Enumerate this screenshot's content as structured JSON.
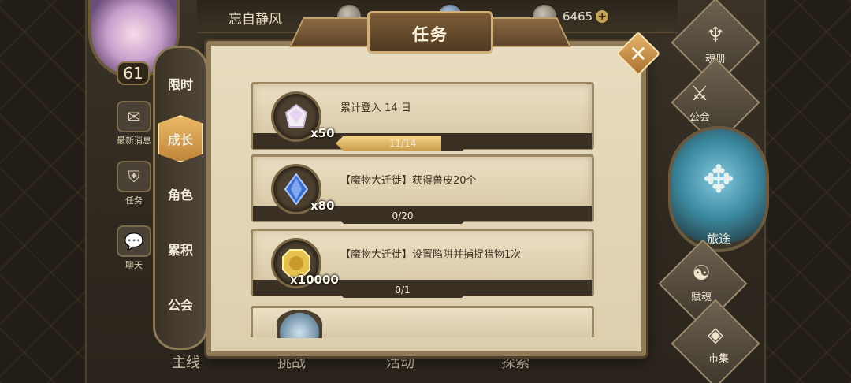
{
  "player": {
    "name": "忘自静风",
    "level": "61"
  },
  "resources": [
    {
      "icon": "silver-coin-icon",
      "value": ""
    },
    {
      "icon": "gem-icon",
      "value": ""
    },
    {
      "icon": "crystal-icon",
      "value": "6465"
    }
  ],
  "left_nav": [
    {
      "label": "最新消息",
      "icon": "news-icon"
    },
    {
      "label": "任务",
      "icon": "quest-icon"
    },
    {
      "label": "聊天",
      "icon": "chat-icon"
    }
  ],
  "dialog": {
    "title": "任务",
    "categories": [
      {
        "label": "限时",
        "active": false
      },
      {
        "label": "成长",
        "active": true
      },
      {
        "label": "角色",
        "active": false
      },
      {
        "label": "累积",
        "active": false
      },
      {
        "label": "公会",
        "active": false
      }
    ],
    "quests": [
      {
        "reward_icon": "crystal-icon",
        "qty": "x50",
        "desc": "累计登入 14 日",
        "progress_text": "11/14",
        "progress": 0.79
      },
      {
        "reward_icon": "blue-gem-icon",
        "qty": "x80",
        "desc": "【魔物大迁徙】获得兽皮20个",
        "progress_text": "0/20",
        "progress": 0
      },
      {
        "reward_icon": "gold-coin-icon",
        "qty": "x10000",
        "desc": "【魔物大迁徙】设置陷阱并捕捉猎物1次",
        "progress_text": "0/1",
        "progress": 0
      }
    ]
  },
  "right_nav": [
    {
      "label": "魂册"
    },
    {
      "label": "公会"
    },
    {
      "label": "旅途"
    },
    {
      "label": "赋魂"
    },
    {
      "label": "市集"
    }
  ],
  "bottom_nav": [
    {
      "label": "主线"
    },
    {
      "label": "挑战"
    },
    {
      "label": "活动"
    },
    {
      "label": "探索"
    }
  ],
  "colors": {
    "accent": "#e9b867",
    "parchment": "#e8dcc0",
    "frame": "#8f7a55"
  }
}
